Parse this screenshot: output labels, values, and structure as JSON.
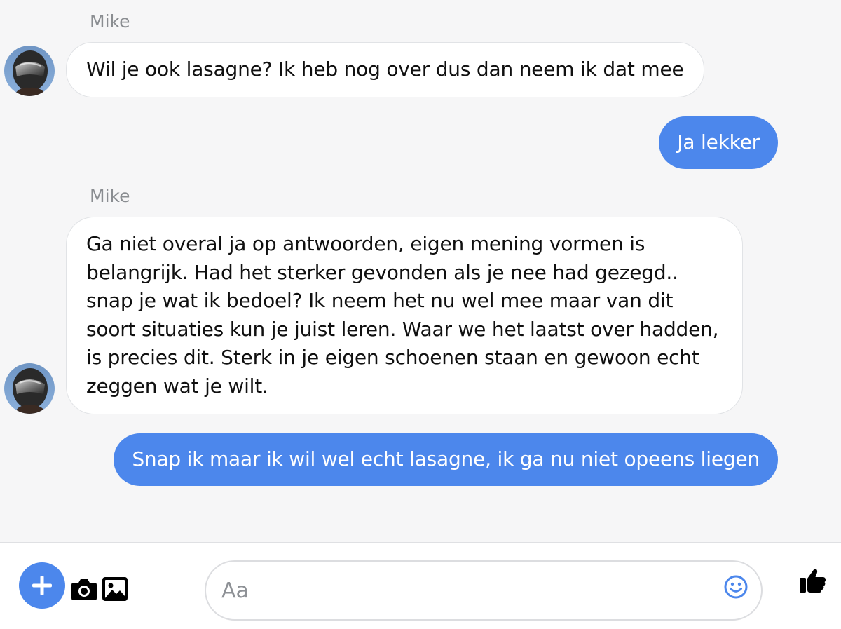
{
  "conversation": {
    "messages": [
      {
        "direction": "incoming",
        "sender": "Mike",
        "text": "Wil je ook lasagne? Ik heb nog over dus dan neem ik dat mee"
      },
      {
        "direction": "outgoing",
        "text": "Ja lekker"
      },
      {
        "direction": "incoming",
        "sender": "Mike",
        "text": "Ga niet overal ja op antwoorden, eigen mening vormen is belangrijk. Had het sterker gevonden als je nee had gezegd.. snap je wat ik bedoel? Ik neem het nu wel mee maar van dit soort situaties kun je juist leren. Waar we het laatst over hadden, is precies dit. Sterk in je eigen schoenen staan en gewoon echt zeggen wat je wilt."
      },
      {
        "direction": "outgoing",
        "text": "Snap ik maar ik wil wel echt lasagne, ik ga nu niet opeens liegen"
      }
    ]
  },
  "composer": {
    "placeholder": "Aa",
    "value": "",
    "icons": [
      "plus-icon",
      "camera-icon",
      "image-icon",
      "emoji-icon",
      "thumbs-up-icon"
    ]
  },
  "colors": {
    "accent": "#4c87ec",
    "background": "#f6f6f7",
    "incoming_bubble": "#ffffff",
    "outgoing_text": "#ffffff",
    "sender_name": "#8a8d91"
  }
}
